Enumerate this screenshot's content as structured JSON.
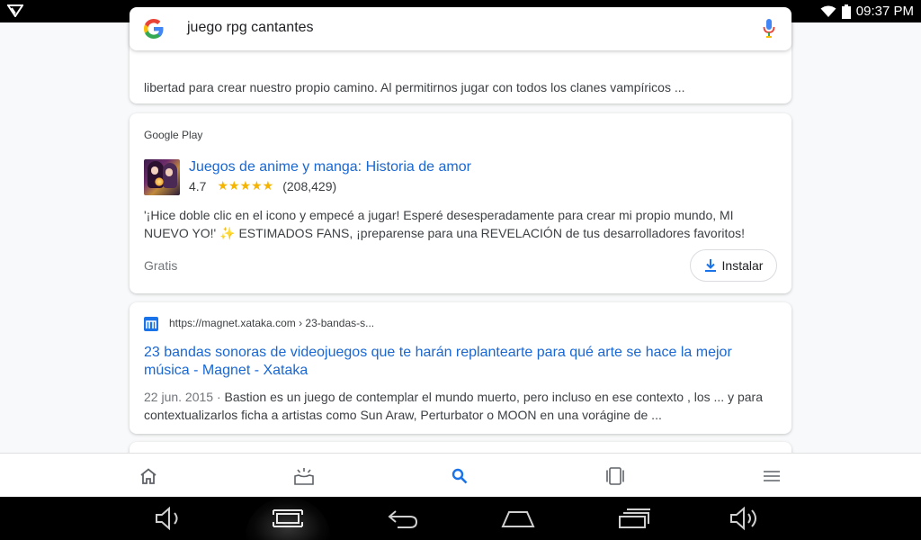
{
  "status_bar": {
    "time": "09:37 PM"
  },
  "search": {
    "query": "juego rpg cantantes"
  },
  "top_card": {
    "snippet": "libertad para crear nuestro propio camino. Al permitirnos jugar con todos los clanes vampíricos ..."
  },
  "play_card": {
    "source": "Google Play",
    "app_title": "Juegos de anime y manga: Historia de amor",
    "rating": "4.7",
    "stars": "★★★★★",
    "rating_count": "(208,429)",
    "description_1": "'¡Hice doble clic en el icono y empecé a jugar! Esperé desesperadamente para crear mi propio mundo, MI NUEVO",
    "description_2": "YO!' ",
    "description_emoji": "✨",
    "description_3": " ESTIMADOS FANS, ¡preparense para una REVELACIÓN de tus desarrolladores favoritos!",
    "price": "Gratis",
    "install_label": "Instalar"
  },
  "web_card": {
    "url": "https://magnet.xataka.com › 23-bandas-s...",
    "title": "23 bandas sonoras de videojuegos que te harán replantearte para qué arte se hace la mejor música - Magnet - Xataka",
    "date": "22 jun. 2015 · ",
    "snippet": "Bastion es un juego de contemplar el mundo muerto, pero incluso en ese contexto , los ... y para contextualizarlos ficha a artistas como Sun Araw, Perturbator o MOON en una vorágine de ..."
  },
  "colors": {
    "link": "#1967d2",
    "star": "#f4b400",
    "accent": "#1a73e8"
  },
  "app_nav": {
    "items": [
      "home-icon",
      "discover-icon",
      "search-icon",
      "tabs-icon",
      "menu-icon"
    ]
  },
  "system_nav": {
    "items": [
      "volume-down-icon",
      "screenshot-icon",
      "back-icon",
      "home-icon",
      "recents-icon",
      "volume-up-icon"
    ]
  }
}
